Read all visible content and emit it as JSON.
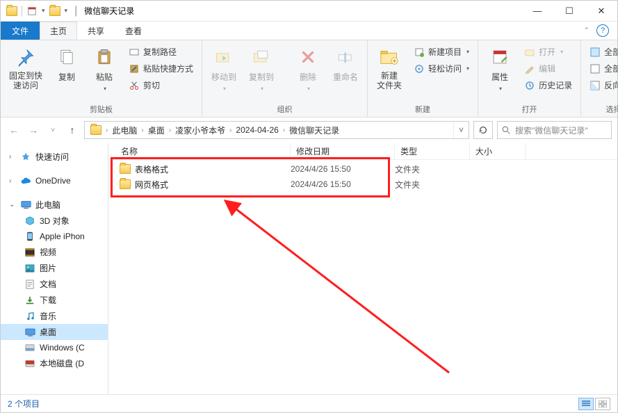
{
  "window": {
    "title": "微信聊天记录"
  },
  "ribbon": {
    "file_tab": "文件",
    "tabs": [
      {
        "label": "主页",
        "active": true
      },
      {
        "label": "共享",
        "active": false
      },
      {
        "label": "查看",
        "active": false
      }
    ],
    "groups": {
      "clipboard": {
        "label": "剪贴板",
        "pin": "固定到快\n速访问",
        "copy": "复制",
        "paste": "粘贴",
        "copy_path": "复制路径",
        "paste_shortcut": "粘贴快捷方式",
        "cut": "剪切"
      },
      "organize": {
        "label": "组织",
        "move_to": "移动到",
        "copy_to": "复制到",
        "delete": "删除",
        "rename": "重命名"
      },
      "new": {
        "label": "新建",
        "new_folder": "新建\n文件夹",
        "new_item": "新建项目",
        "easy_access": "轻松访问"
      },
      "open": {
        "label": "打开",
        "properties": "属性",
        "open": "打开",
        "edit": "编辑",
        "history": "历史记录"
      },
      "select": {
        "label": "选择",
        "select_all": "全部选择",
        "select_none": "全部取消",
        "invert_selection": "反向选择"
      }
    }
  },
  "breadcrumb": {
    "items": [
      "此电脑",
      "桌面",
      "凌家小爷本爷",
      "2024-04-26",
      "微信聊天记录"
    ]
  },
  "search": {
    "placeholder": "搜索\"微信聊天记录\""
  },
  "navpane": {
    "quick_access": "快速访问",
    "onedrive": "OneDrive",
    "this_pc": "此电脑",
    "items": [
      {
        "label": "3D 对象"
      },
      {
        "label": "Apple iPhon"
      },
      {
        "label": "视频"
      },
      {
        "label": "图片"
      },
      {
        "label": "文档"
      },
      {
        "label": "下载"
      },
      {
        "label": "音乐"
      },
      {
        "label": "桌面",
        "selected": true
      },
      {
        "label": "Windows (C"
      },
      {
        "label": "本地磁盘 (D"
      }
    ]
  },
  "columns": {
    "name": "名称",
    "modified": "修改日期",
    "type": "类型",
    "size": "大小"
  },
  "files": [
    {
      "name": "表格格式",
      "date": "2024/4/26 15:50",
      "type": "文件夹"
    },
    {
      "name": "网页格式",
      "date": "2024/4/26 15:50",
      "type": "文件夹"
    }
  ],
  "statusbar": {
    "item_count": "2 个项目"
  }
}
